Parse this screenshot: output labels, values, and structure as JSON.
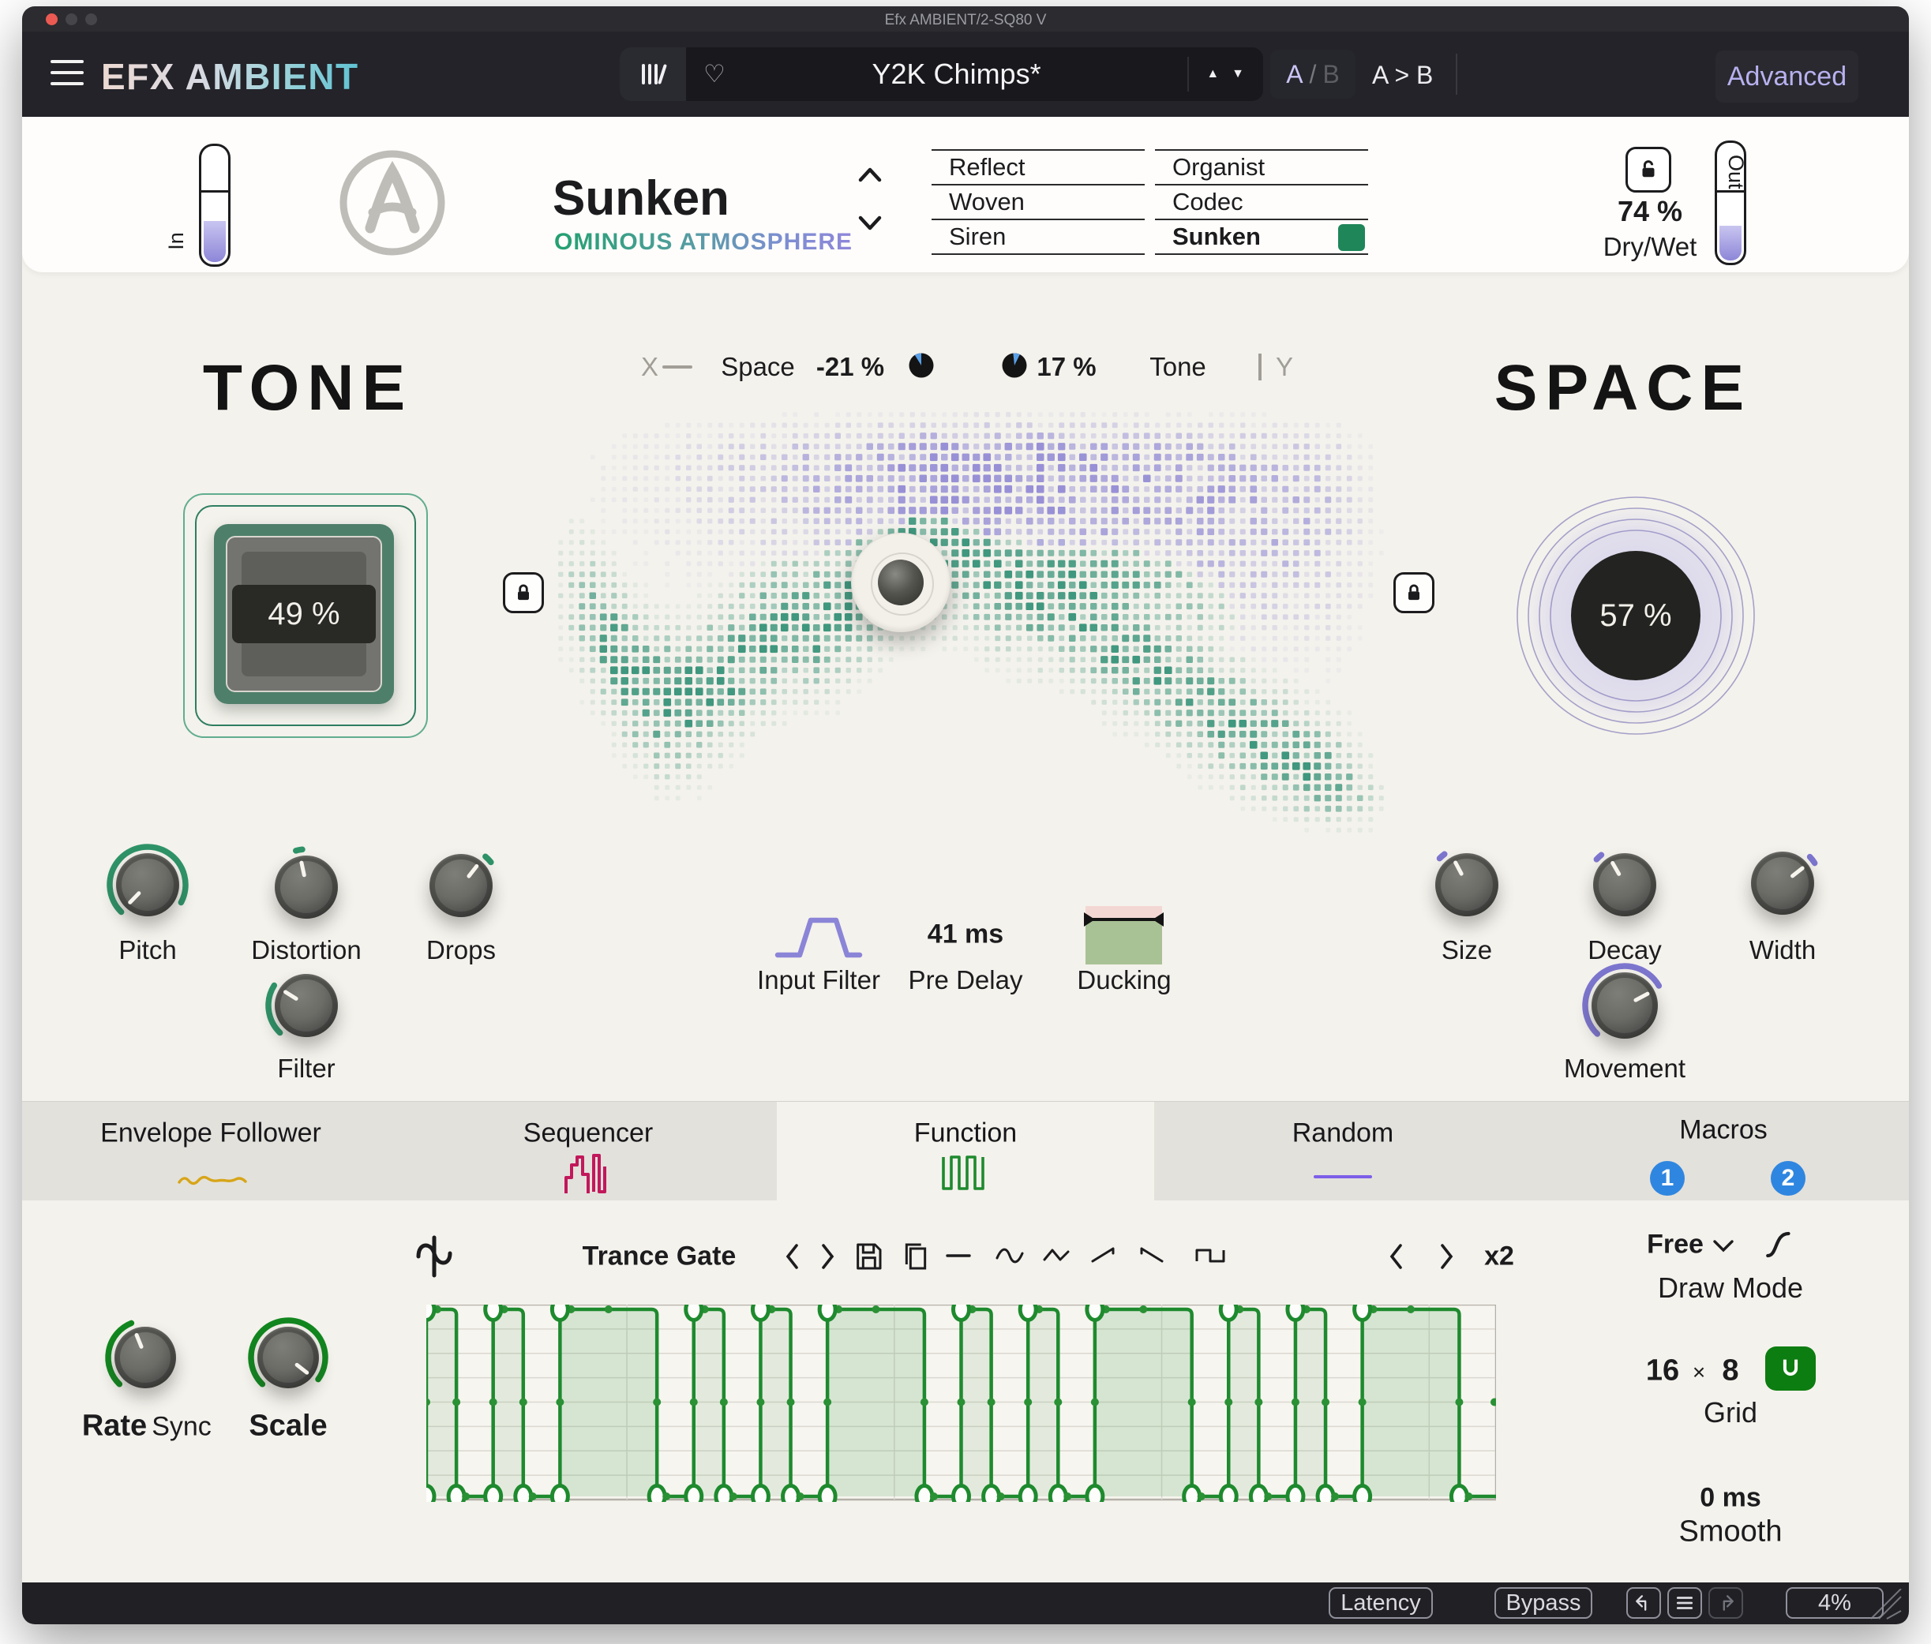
{
  "window_title": "Efx AMBIENT/2-SQ80 V",
  "topbar": {
    "brand": "EFX AMBIENT",
    "preset_name": "Y2K Chimps*",
    "ab_a": "A",
    "ab_sep": "/",
    "ab_b": "B",
    "ab_copy": "A > B",
    "advanced": "Advanced"
  },
  "header": {
    "in_label": "In",
    "out_label": "Out",
    "preset_title": "Sunken",
    "preset_subtitle": "OMINOUS ATMOSPHERE",
    "preset_columns": {
      "left": [
        "Reflect",
        "Woven",
        "Siren"
      ],
      "right": [
        "Organist",
        "Codec",
        "Sunken"
      ]
    },
    "selected_preset": "Sunken",
    "dry_wet_value": "74 %",
    "dry_wet_label": "Dry/Wet"
  },
  "main": {
    "tone_title": "TONE",
    "space_title": "SPACE",
    "x_label": "X",
    "space_label": "Space",
    "space_xy_value": "-21 %",
    "tone_xy_value": "17 %",
    "tone_label": "Tone",
    "y_label": "Y",
    "tone_value": "49 %",
    "space_value": "57 %",
    "input_filter_label": "Input Filter",
    "pre_delay_value": "41 ms",
    "pre_delay_label": "Pre Delay",
    "ducking_label": "Ducking",
    "sync_label": "Sync",
    "knob_labels": {
      "pitch": "Pitch",
      "distortion": "Distortion",
      "drops": "Drops",
      "filter": "Filter",
      "size": "Size",
      "decay": "Decay",
      "width": "Width",
      "movement": "Movement",
      "rate": "Rate",
      "scale": "Scale"
    }
  },
  "knob_state": {
    "pitch": {
      "pointer_deg": -136,
      "arc": [
        -136,
        118
      ],
      "accent": "#2f9368"
    },
    "distortion": {
      "pointer_deg": -12,
      "arc": [
        -16,
        -6
      ],
      "accent": "#2f9368"
    },
    "drops": {
      "pointer_deg": 38,
      "arc": [
        40,
        52
      ],
      "accent": "#2f9368"
    },
    "filter": {
      "pointer_deg": -58,
      "arc": [
        -136,
        -58
      ],
      "accent": "#2f9368"
    },
    "size": {
      "pointer_deg": -28,
      "arc": [
        -46,
        -36
      ],
      "accent": "#7d76cf"
    },
    "decay": {
      "pointer_deg": -30,
      "arc": [
        -48,
        -38
      ],
      "accent": "#7d76cf"
    },
    "width": {
      "pointer_deg": 52,
      "arc": [
        46,
        58
      ],
      "accent": "#7d76cf"
    },
    "movement": {
      "pointer_deg": 62,
      "arc": [
        -136,
        60
      ],
      "accent": "#7d76cf"
    },
    "rate": {
      "pointer_deg": -22,
      "arc": [
        -136,
        -22
      ],
      "accent": "#12871f"
    },
    "scale": {
      "pointer_deg": 128,
      "arc": [
        -136,
        126
      ],
      "accent": "#12871f"
    }
  },
  "xy_pies": {
    "space": [
      -32,
      0
    ],
    "tone": [
      -6,
      26
    ]
  },
  "tabs": [
    {
      "label": "Envelope Follower",
      "active": false
    },
    {
      "label": "Sequencer",
      "active": false
    },
    {
      "label": "Function",
      "active": true
    },
    {
      "label": "Random",
      "active": false
    }
  ],
  "macros": {
    "label": "Macros",
    "buttons": [
      "1",
      "2"
    ]
  },
  "function_panel": {
    "preset_label": "Trance Gate",
    "repeat_label": "x2",
    "draw_mode_value": "Free",
    "draw_mode_label": "Draw Mode",
    "grid_cols": "16",
    "grid_x": "×",
    "grid_rows": "8",
    "grid_label": "Grid",
    "smooth_value": "0 ms",
    "smooth_label": "Smooth",
    "gate_segments": [
      [
        0,
        0.45
      ],
      [
        1,
        1.45
      ],
      [
        2,
        3.45
      ],
      [
        4,
        4.45
      ],
      [
        5,
        5.45
      ],
      [
        6,
        7.45
      ],
      [
        8,
        8.45
      ],
      [
        9,
        9.45
      ],
      [
        10,
        11.45
      ],
      [
        12,
        12.45
      ],
      [
        13,
        13.45
      ],
      [
        14,
        15.45
      ]
    ]
  },
  "bottombar": {
    "latency": "Latency",
    "bypass": "Bypass",
    "zoom": "4%"
  },
  "colors": {
    "gate_green": "#1e8a2e",
    "accent_purple": "#8b85d8",
    "macro_blue": "#2f86e0",
    "selected_green": "#1f8659"
  }
}
